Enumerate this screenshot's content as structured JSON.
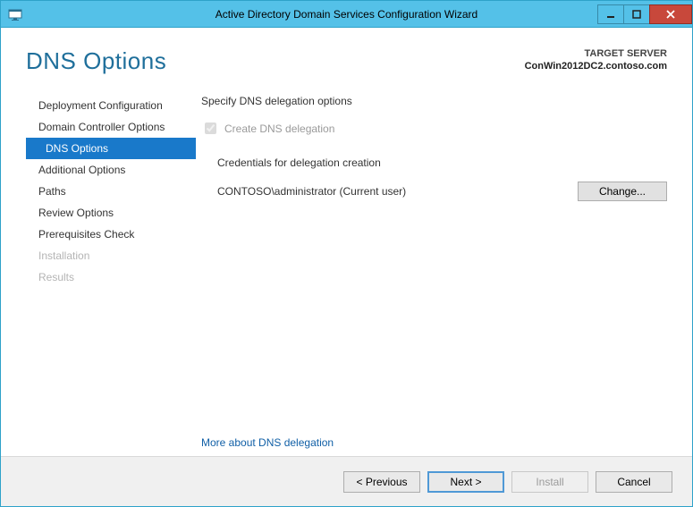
{
  "window": {
    "title": "Active Directory Domain Services Configuration Wizard"
  },
  "page": {
    "title": "DNS Options"
  },
  "target": {
    "label": "TARGET SERVER",
    "value": "ConWin2012DC2.contoso.com"
  },
  "sidebar": {
    "items": [
      {
        "label": "Deployment Configuration",
        "state": "normal"
      },
      {
        "label": "Domain Controller Options",
        "state": "normal"
      },
      {
        "label": "DNS Options",
        "state": "active"
      },
      {
        "label": "Additional Options",
        "state": "normal"
      },
      {
        "label": "Paths",
        "state": "normal"
      },
      {
        "label": "Review Options",
        "state": "normal"
      },
      {
        "label": "Prerequisites Check",
        "state": "normal"
      },
      {
        "label": "Installation",
        "state": "disabled"
      },
      {
        "label": "Results",
        "state": "disabled"
      }
    ]
  },
  "content": {
    "heading": "Specify DNS delegation options",
    "checkbox_label": "Create DNS delegation",
    "checkbox_checked": true,
    "checkbox_disabled": true,
    "sub_heading": "Credentials for delegation creation",
    "credential": "CONTOSO\\administrator (Current user)",
    "change_button": "Change...",
    "more_link": "More about DNS delegation"
  },
  "footer": {
    "previous": "< Previous",
    "next": "Next >",
    "install": "Install",
    "cancel": "Cancel"
  }
}
